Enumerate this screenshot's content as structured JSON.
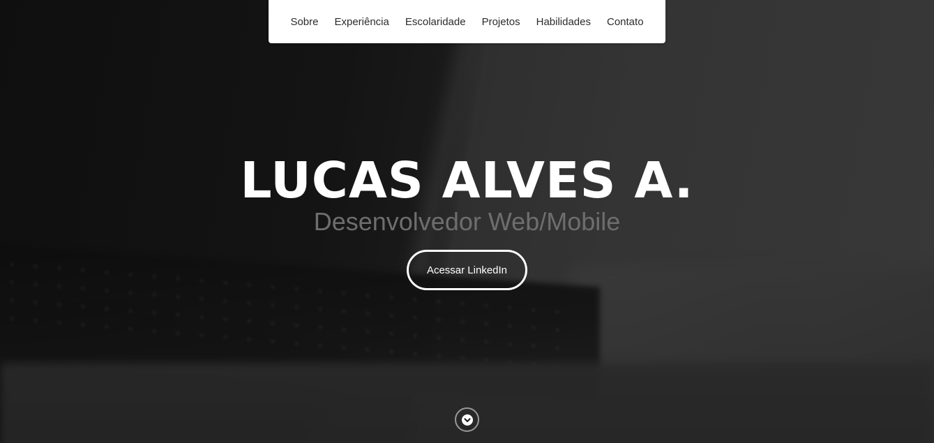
{
  "nav": {
    "items": [
      {
        "label": "Sobre"
      },
      {
        "label": "Experiência"
      },
      {
        "label": "Escolaridade"
      },
      {
        "label": "Projetos"
      },
      {
        "label": "Habilidades"
      },
      {
        "label": "Contato"
      }
    ]
  },
  "hero": {
    "title": "LUCAS ALVES A.",
    "subtitle": "Desenvolvedor Web/Mobile",
    "button_label": "Acessar LinkedIn",
    "scroll_icon": "chevron-down-icon"
  },
  "colors": {
    "title": "#ffffff",
    "subtitle": "#6e6e6e",
    "nav_background": "#ffffff",
    "nav_text": "#2b2b2b",
    "button_border": "#ffffff"
  }
}
